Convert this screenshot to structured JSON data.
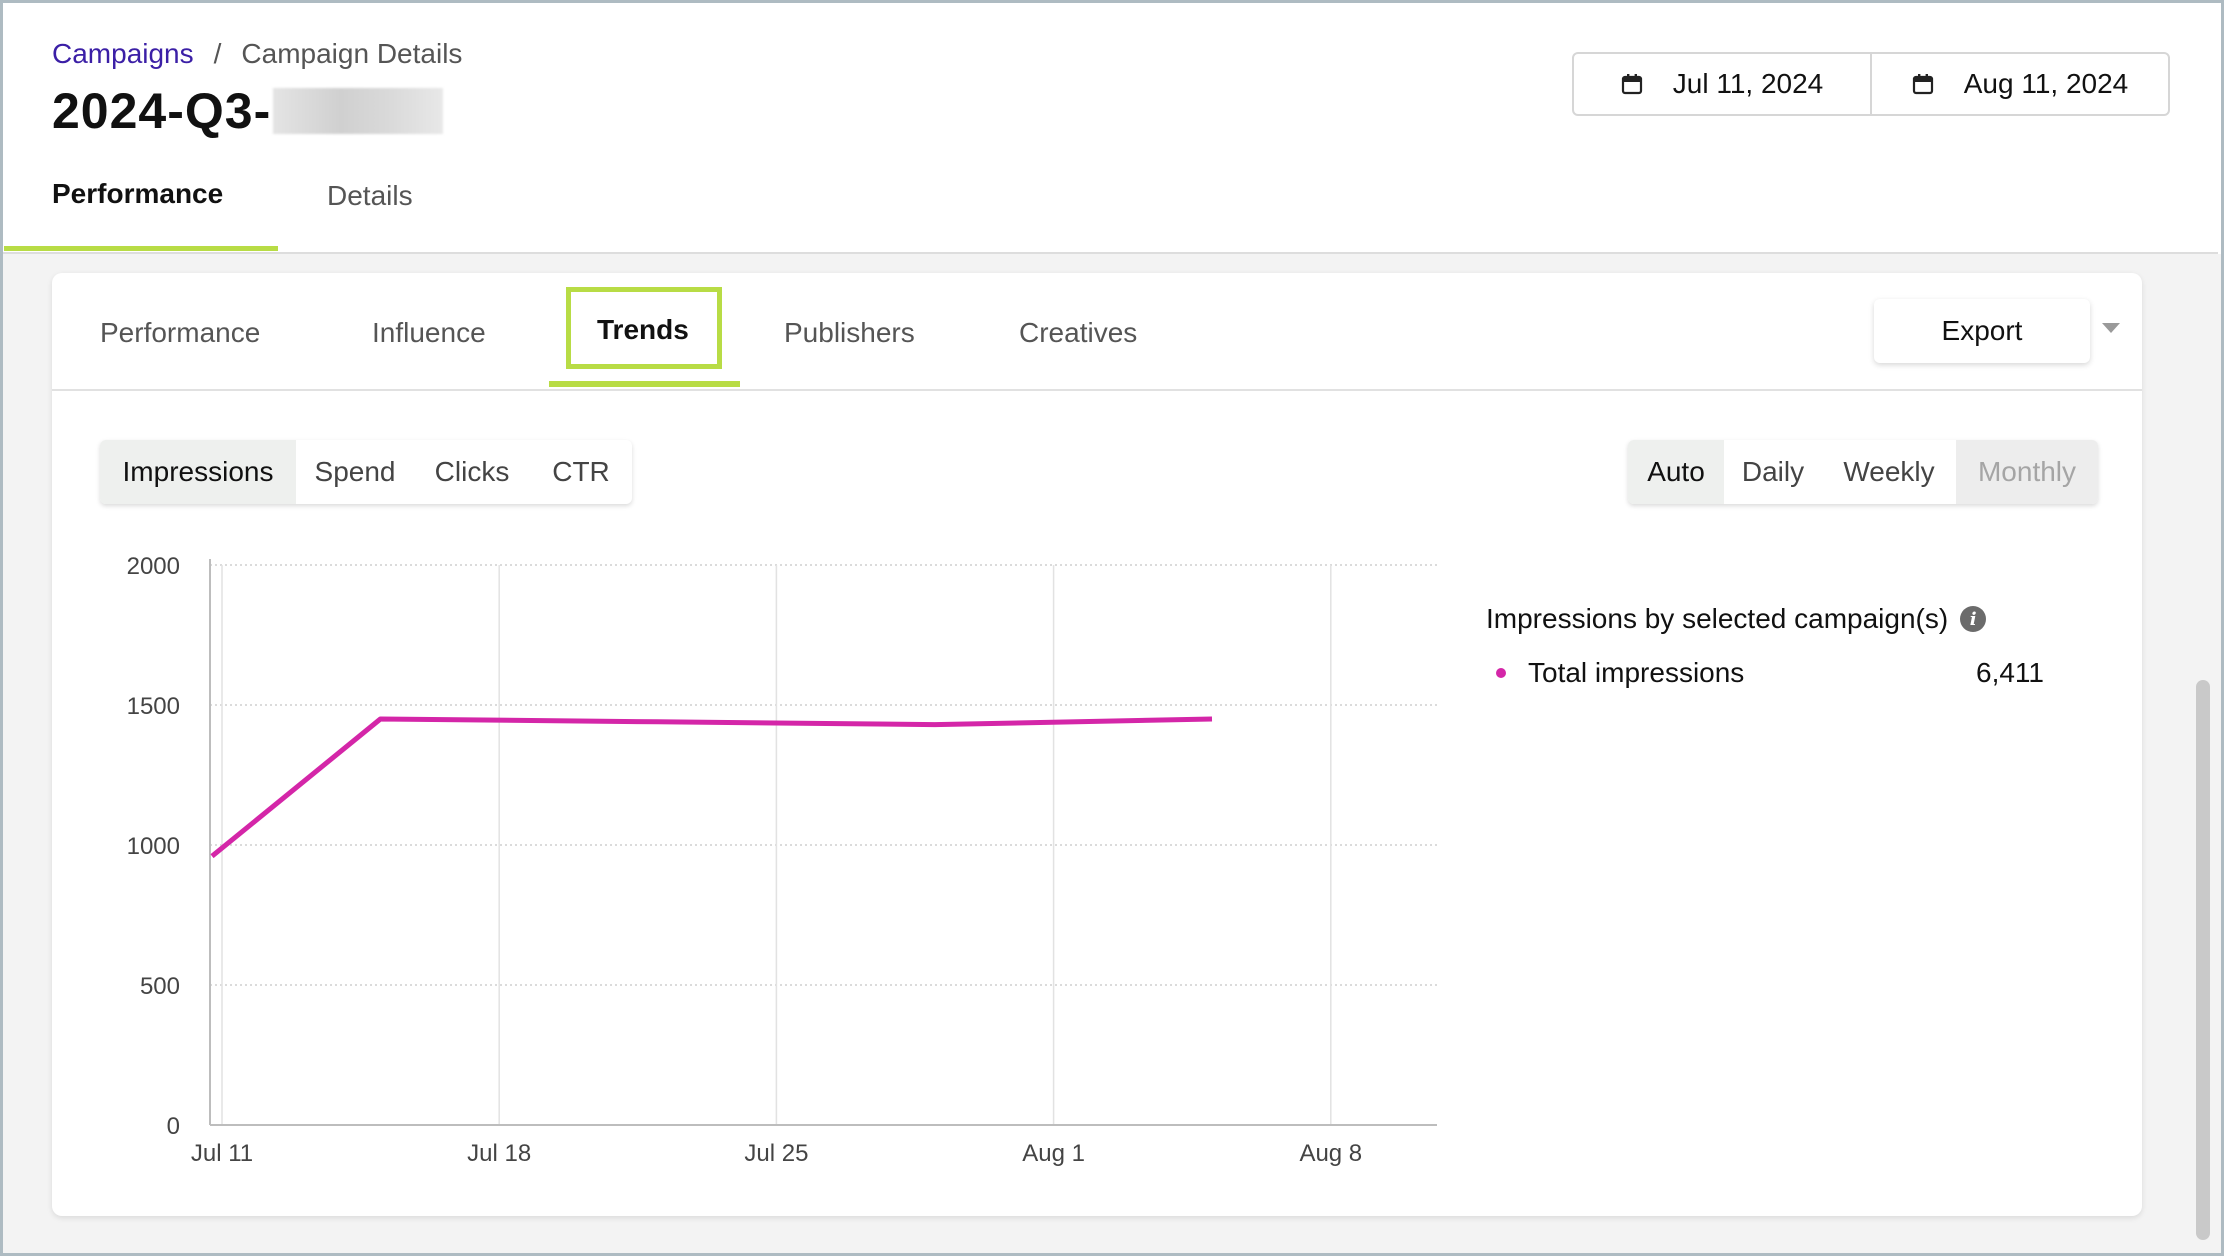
{
  "breadcrumb": {
    "parent": "Campaigns",
    "separator": "/",
    "current": "Campaign Details"
  },
  "page_title": "2024-Q3-",
  "date_range": {
    "start": "Jul 11, 2024",
    "end": "Aug 11, 2024"
  },
  "main_tabs": [
    {
      "label": "Performance",
      "active": true
    },
    {
      "label": "Details",
      "active": false
    }
  ],
  "sub_tabs": [
    {
      "label": "Performance",
      "active": false
    },
    {
      "label": "Influence",
      "active": false
    },
    {
      "label": "Trends",
      "active": true
    },
    {
      "label": "Publishers",
      "active": false
    },
    {
      "label": "Creatives",
      "active": false
    }
  ],
  "export_label": "Export",
  "metric_toggle": [
    {
      "label": "Impressions",
      "active": true
    },
    {
      "label": "Spend",
      "active": false
    },
    {
      "label": "Clicks",
      "active": false
    },
    {
      "label": "CTR",
      "active": false
    }
  ],
  "interval_toggle": [
    {
      "label": "Auto",
      "active": true
    },
    {
      "label": "Daily",
      "active": false
    },
    {
      "label": "Weekly",
      "active": false
    },
    {
      "label": "Monthly",
      "disabled": true
    }
  ],
  "legend": {
    "title": "Impressions by selected campaign(s)",
    "info_icon": "info-icon",
    "items": [
      {
        "label": "Total impressions",
        "value": "6,411",
        "color": "#d426a8"
      }
    ]
  },
  "colors": {
    "accent": "#b8dc45",
    "link": "#3b1fa6",
    "series": "#d426a8"
  },
  "chart_data": {
    "type": "line",
    "x_tick_labels": [
      "Jul 11",
      "Jul 18",
      "Jul 25",
      "Aug 1",
      "Aug 8"
    ],
    "x_ticks": [
      "2024-07-11",
      "2024-07-18",
      "2024-07-25",
      "2024-08-01",
      "2024-08-08"
    ],
    "y_ticks": [
      0,
      500,
      1000,
      1500,
      2000
    ],
    "ylim": [
      0,
      2000
    ],
    "xlim": [
      "2024-07-11",
      "2024-08-11"
    ],
    "grid": true,
    "series": [
      {
        "name": "Total impressions",
        "color": "#d426a8",
        "x": [
          "2024-07-11",
          "2024-07-15",
          "2024-07-22",
          "2024-07-29",
          "2024-08-05"
        ],
        "y": [
          960,
          1450,
          1440,
          1430,
          1450
        ]
      }
    ]
  }
}
